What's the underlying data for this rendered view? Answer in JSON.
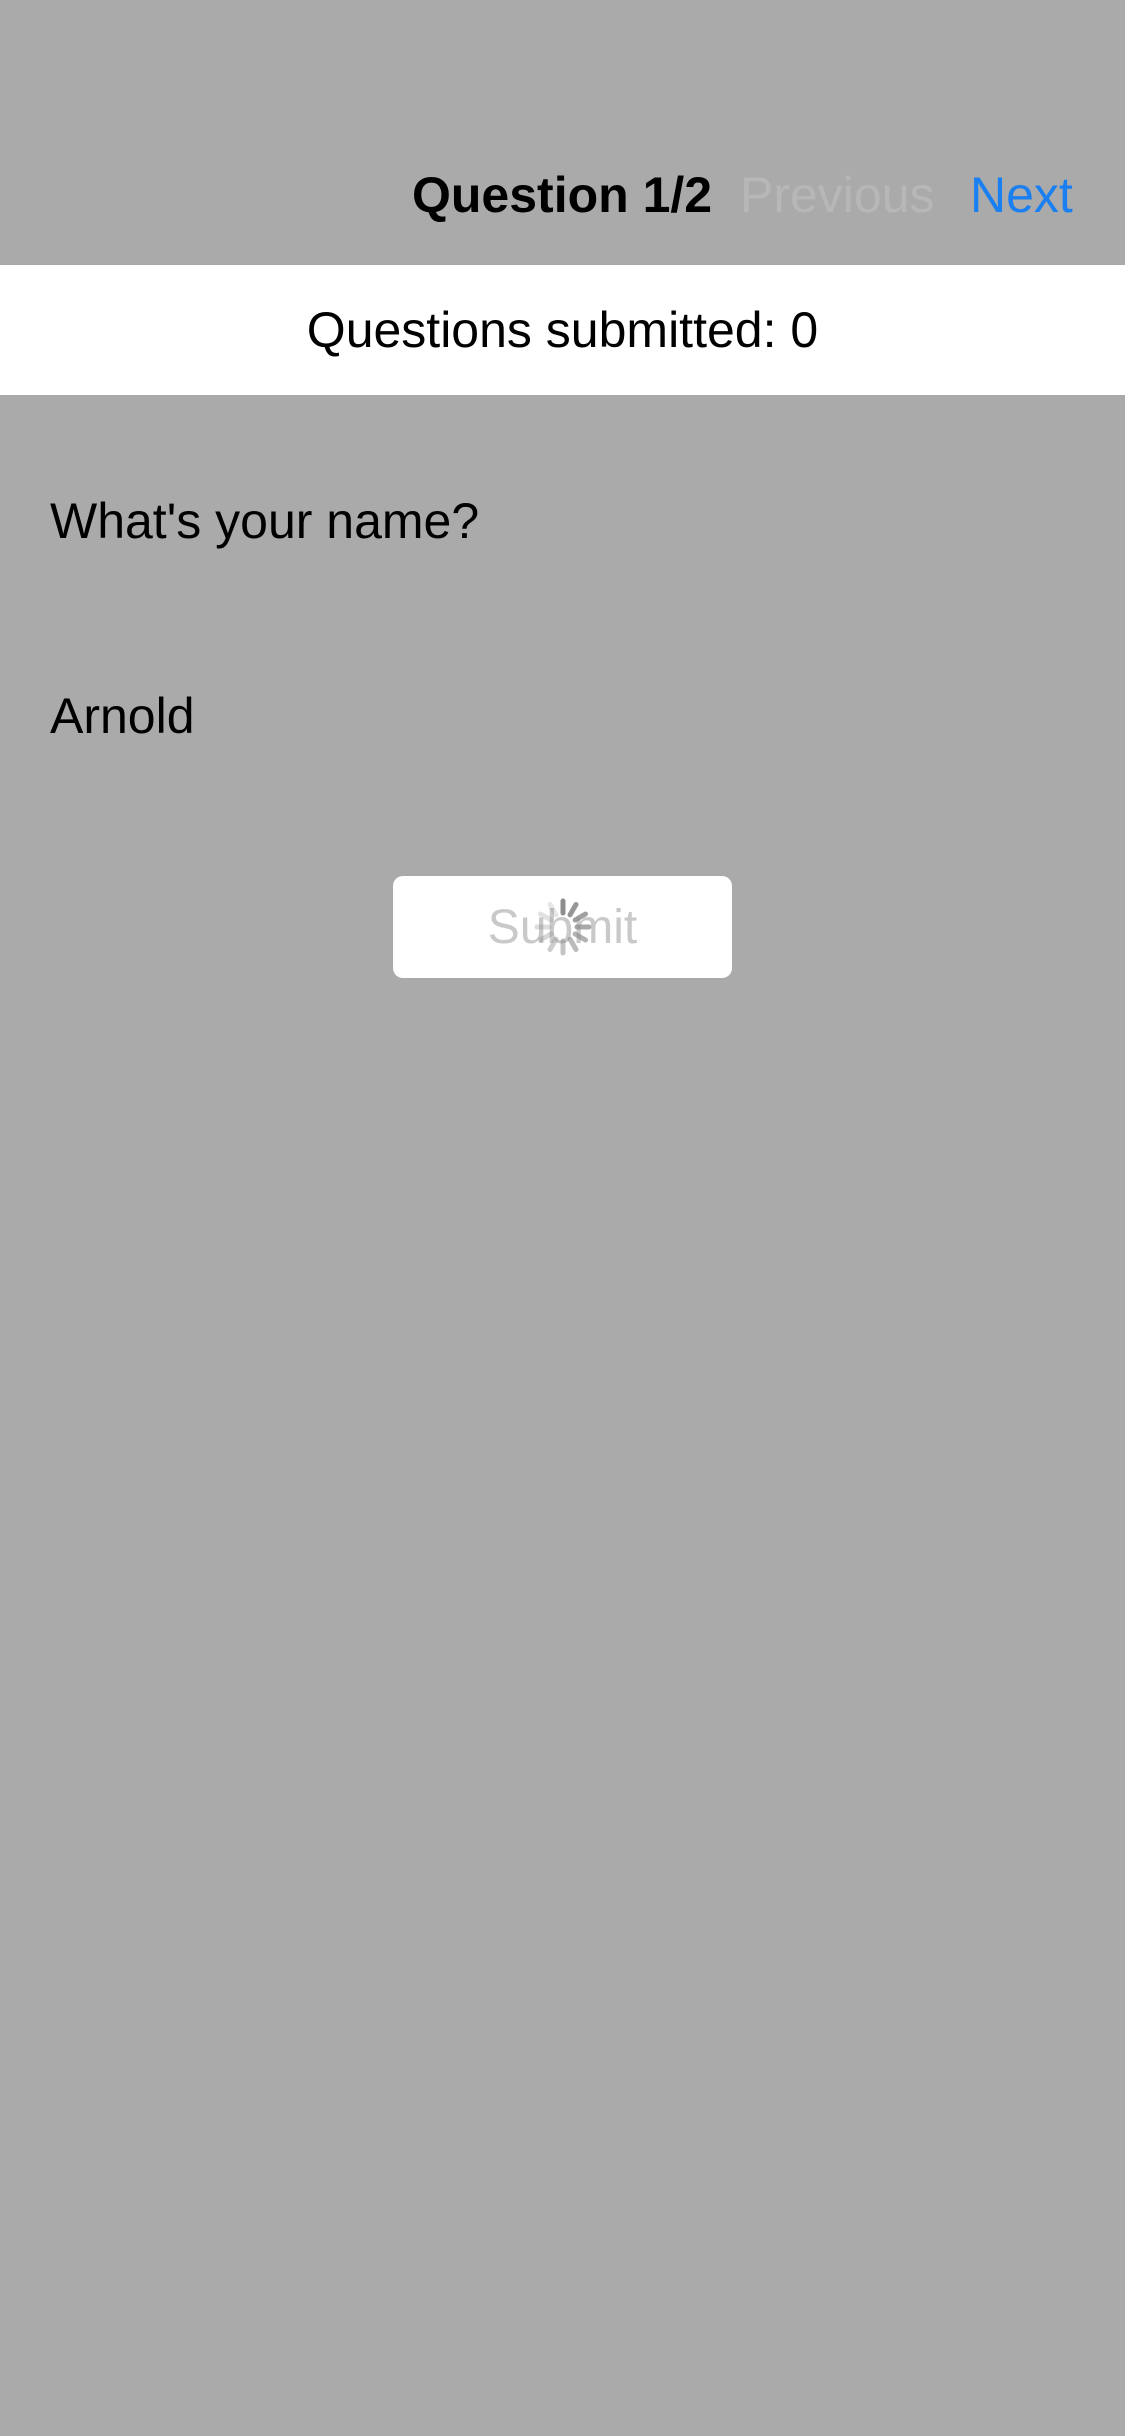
{
  "nav": {
    "title": "Question 1/2",
    "previous_label": "Previous",
    "next_label": "Next"
  },
  "status": {
    "submitted_text": "Questions submitted: 0"
  },
  "question": {
    "label": "What's your name?",
    "answer_value": "Arnold"
  },
  "submit": {
    "label": "Submit",
    "loading": true,
    "spinner_icon": "activity-spinner-icon"
  },
  "colors": {
    "background": "#aaaaaa",
    "accent": "#1a7ff0",
    "disabled_text": "#b7b7b7",
    "surface": "#ffffff"
  }
}
